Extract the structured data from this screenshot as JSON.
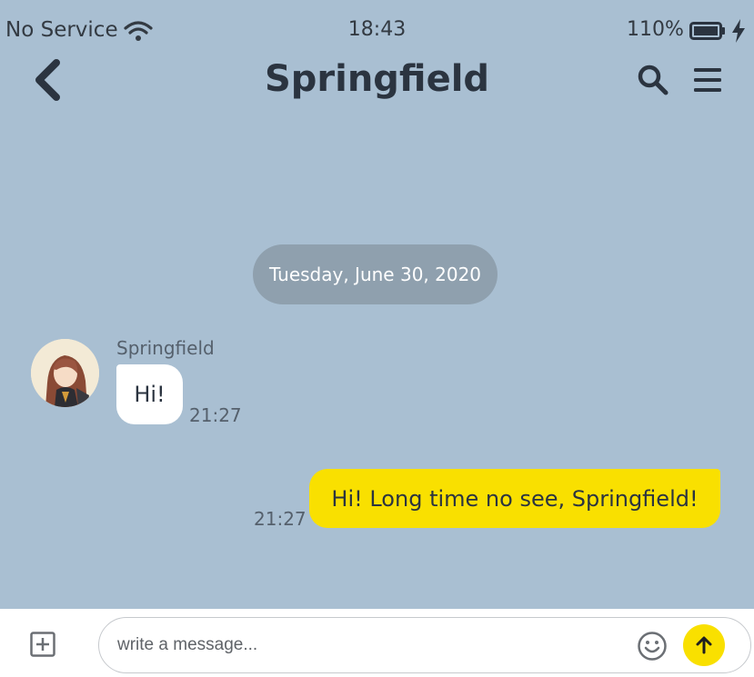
{
  "status_bar": {
    "carrier": "No Service",
    "time": "18:43",
    "battery_percent": "110%",
    "icons": [
      "wifi-icon",
      "battery-icon",
      "charging-bolt-icon"
    ]
  },
  "header": {
    "title": "Springfield",
    "icons": [
      "chevron-left-icon",
      "search-icon",
      "hamburger-menu-icon"
    ]
  },
  "chat": {
    "date_separator": "Tuesday, June 30, 2020",
    "messages": [
      {
        "direction": "incoming",
        "sender": "Springfield",
        "text": "Hi!",
        "time": "21:27"
      },
      {
        "direction": "outgoing",
        "text": "Hi! Long time no see, Springfield!",
        "time": "21:27"
      }
    ]
  },
  "composer": {
    "placeholder": "write a message...",
    "value": "",
    "icons": [
      "add-square-icon",
      "emoji-icon",
      "send-arrow-up-icon"
    ]
  },
  "colors": {
    "background": "#a9bfd2",
    "date_pill": "#8fa0ae",
    "incoming_bubble": "#ffffff",
    "outgoing_bubble": "#f9e000",
    "send_button": "#f9e000"
  }
}
